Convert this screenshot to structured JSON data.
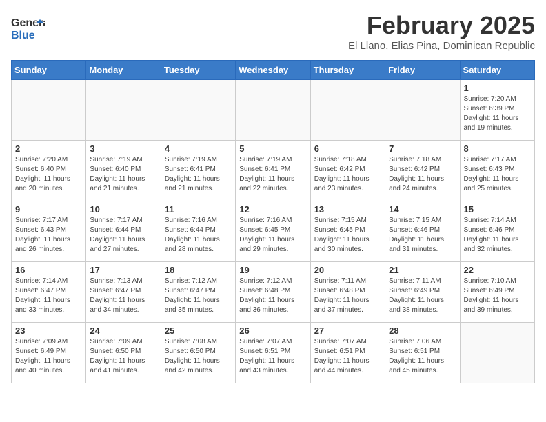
{
  "header": {
    "logo_general": "General",
    "logo_blue": "Blue",
    "month": "February 2025",
    "location": "El Llano, Elias Pina, Dominican Republic"
  },
  "days_of_week": [
    "Sunday",
    "Monday",
    "Tuesday",
    "Wednesday",
    "Thursday",
    "Friday",
    "Saturday"
  ],
  "weeks": [
    [
      {
        "day": "",
        "info": ""
      },
      {
        "day": "",
        "info": ""
      },
      {
        "day": "",
        "info": ""
      },
      {
        "day": "",
        "info": ""
      },
      {
        "day": "",
        "info": ""
      },
      {
        "day": "",
        "info": ""
      },
      {
        "day": "1",
        "info": "Sunrise: 7:20 AM\nSunset: 6:39 PM\nDaylight: 11 hours and 19 minutes."
      }
    ],
    [
      {
        "day": "2",
        "info": "Sunrise: 7:20 AM\nSunset: 6:40 PM\nDaylight: 11 hours and 20 minutes."
      },
      {
        "day": "3",
        "info": "Sunrise: 7:19 AM\nSunset: 6:40 PM\nDaylight: 11 hours and 21 minutes."
      },
      {
        "day": "4",
        "info": "Sunrise: 7:19 AM\nSunset: 6:41 PM\nDaylight: 11 hours and 21 minutes."
      },
      {
        "day": "5",
        "info": "Sunrise: 7:19 AM\nSunset: 6:41 PM\nDaylight: 11 hours and 22 minutes."
      },
      {
        "day": "6",
        "info": "Sunrise: 7:18 AM\nSunset: 6:42 PM\nDaylight: 11 hours and 23 minutes."
      },
      {
        "day": "7",
        "info": "Sunrise: 7:18 AM\nSunset: 6:42 PM\nDaylight: 11 hours and 24 minutes."
      },
      {
        "day": "8",
        "info": "Sunrise: 7:17 AM\nSunset: 6:43 PM\nDaylight: 11 hours and 25 minutes."
      }
    ],
    [
      {
        "day": "9",
        "info": "Sunrise: 7:17 AM\nSunset: 6:43 PM\nDaylight: 11 hours and 26 minutes."
      },
      {
        "day": "10",
        "info": "Sunrise: 7:17 AM\nSunset: 6:44 PM\nDaylight: 11 hours and 27 minutes."
      },
      {
        "day": "11",
        "info": "Sunrise: 7:16 AM\nSunset: 6:44 PM\nDaylight: 11 hours and 28 minutes."
      },
      {
        "day": "12",
        "info": "Sunrise: 7:16 AM\nSunset: 6:45 PM\nDaylight: 11 hours and 29 minutes."
      },
      {
        "day": "13",
        "info": "Sunrise: 7:15 AM\nSunset: 6:45 PM\nDaylight: 11 hours and 30 minutes."
      },
      {
        "day": "14",
        "info": "Sunrise: 7:15 AM\nSunset: 6:46 PM\nDaylight: 11 hours and 31 minutes."
      },
      {
        "day": "15",
        "info": "Sunrise: 7:14 AM\nSunset: 6:46 PM\nDaylight: 11 hours and 32 minutes."
      }
    ],
    [
      {
        "day": "16",
        "info": "Sunrise: 7:14 AM\nSunset: 6:47 PM\nDaylight: 11 hours and 33 minutes."
      },
      {
        "day": "17",
        "info": "Sunrise: 7:13 AM\nSunset: 6:47 PM\nDaylight: 11 hours and 34 minutes."
      },
      {
        "day": "18",
        "info": "Sunrise: 7:12 AM\nSunset: 6:47 PM\nDaylight: 11 hours and 35 minutes."
      },
      {
        "day": "19",
        "info": "Sunrise: 7:12 AM\nSunset: 6:48 PM\nDaylight: 11 hours and 36 minutes."
      },
      {
        "day": "20",
        "info": "Sunrise: 7:11 AM\nSunset: 6:48 PM\nDaylight: 11 hours and 37 minutes."
      },
      {
        "day": "21",
        "info": "Sunrise: 7:11 AM\nSunset: 6:49 PM\nDaylight: 11 hours and 38 minutes."
      },
      {
        "day": "22",
        "info": "Sunrise: 7:10 AM\nSunset: 6:49 PM\nDaylight: 11 hours and 39 minutes."
      }
    ],
    [
      {
        "day": "23",
        "info": "Sunrise: 7:09 AM\nSunset: 6:49 PM\nDaylight: 11 hours and 40 minutes."
      },
      {
        "day": "24",
        "info": "Sunrise: 7:09 AM\nSunset: 6:50 PM\nDaylight: 11 hours and 41 minutes."
      },
      {
        "day": "25",
        "info": "Sunrise: 7:08 AM\nSunset: 6:50 PM\nDaylight: 11 hours and 42 minutes."
      },
      {
        "day": "26",
        "info": "Sunrise: 7:07 AM\nSunset: 6:51 PM\nDaylight: 11 hours and 43 minutes."
      },
      {
        "day": "27",
        "info": "Sunrise: 7:07 AM\nSunset: 6:51 PM\nDaylight: 11 hours and 44 minutes."
      },
      {
        "day": "28",
        "info": "Sunrise: 7:06 AM\nSunset: 6:51 PM\nDaylight: 11 hours and 45 minutes."
      },
      {
        "day": "",
        "info": ""
      }
    ]
  ]
}
